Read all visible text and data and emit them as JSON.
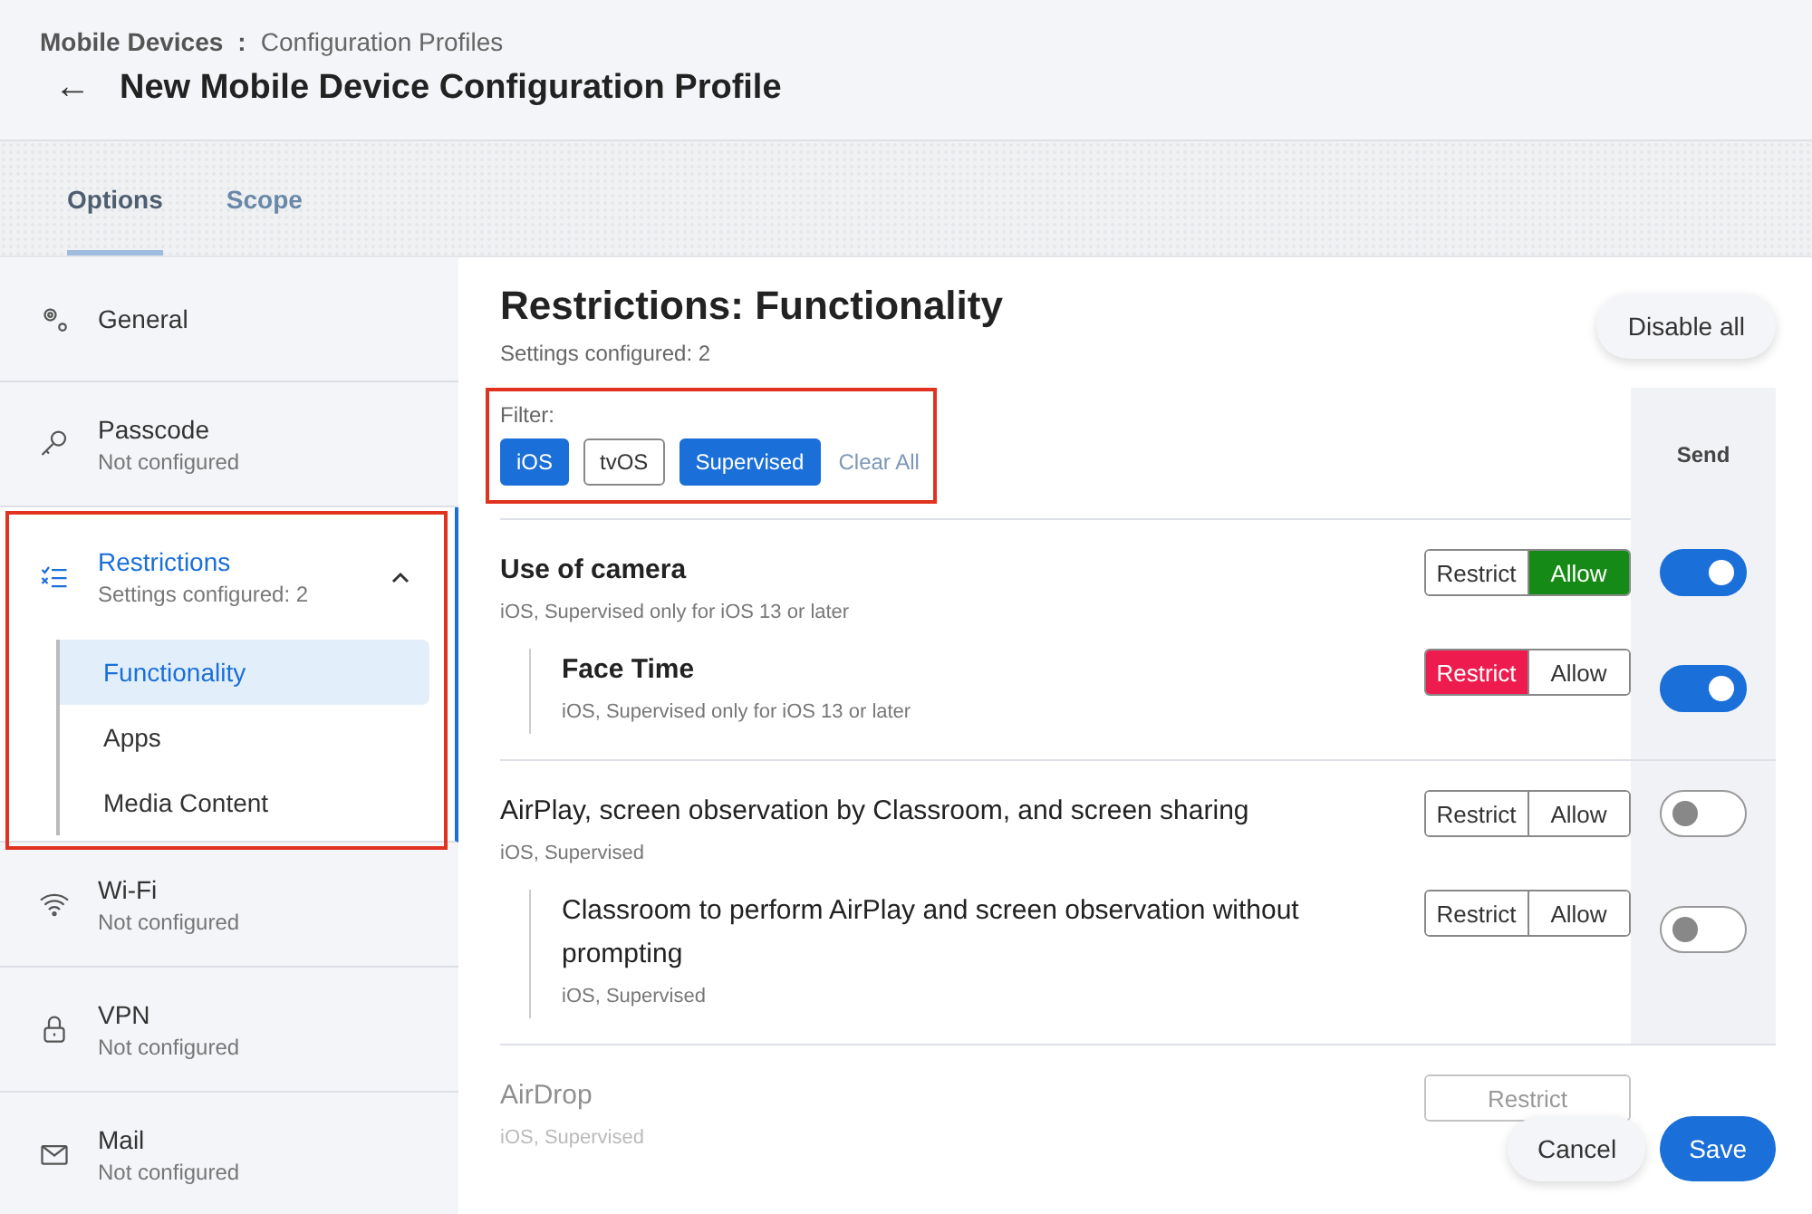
{
  "breadcrumb": {
    "parent": "Mobile Devices",
    "separator": ":",
    "current": "Configuration Profiles"
  },
  "back": "←",
  "title": "New Mobile Device Configuration Profile",
  "tabs": [
    {
      "label": "Options",
      "selected": true
    },
    {
      "label": "Scope",
      "selected": false
    }
  ],
  "sidebar": {
    "items": [
      {
        "kind": "gear",
        "label": "General",
        "selected": false
      },
      {
        "kind": "key",
        "label": "Passcode",
        "status": "Not configured",
        "selected": false
      },
      {
        "kind": "checklist",
        "label": "Restrictions",
        "status": "Settings configured: 2",
        "selected": true,
        "expanded": true,
        "highlighted": true,
        "children": [
          {
            "label": "Functionality",
            "selected": true
          },
          {
            "label": "Apps",
            "selected": false
          },
          {
            "label": "Media Content",
            "selected": false
          }
        ]
      },
      {
        "kind": "wifi",
        "label": "Wi-Fi",
        "status": "Not configured",
        "selected": false
      },
      {
        "kind": "lock",
        "label": "VPN",
        "status": "Not configured",
        "selected": false
      },
      {
        "kind": "mail",
        "label": "Mail",
        "status": "Not configured",
        "selected": false
      }
    ]
  },
  "panel": {
    "title": "Restrictions: Functionality",
    "subtitle": "Settings configured: 2",
    "disable_all": "Disable all",
    "filter": {
      "label": "Filter:",
      "highlighted": true,
      "chips": [
        {
          "label": "iOS",
          "selected": true
        },
        {
          "label": "tvOS",
          "selected": false
        },
        {
          "label": "Supervised",
          "selected": true
        }
      ],
      "clear": "Clear All"
    },
    "send_header": "Send",
    "settings": [
      {
        "title": "Use of camera",
        "bold": true,
        "subtitle": "iOS, Supervised only for iOS 13 or later",
        "options": [
          {
            "label": "Restrict",
            "selected": false
          },
          {
            "label": "Allow",
            "selected": true
          }
        ],
        "send": true,
        "faded": false,
        "children": [
          {
            "title": "Face Time",
            "bold": true,
            "subtitle": "iOS, Supervised only for iOS 13 or later",
            "options": [
              {
                "label": "Restrict",
                "selected": true
              },
              {
                "label": "Allow",
                "selected": false
              }
            ],
            "send": true
          }
        ]
      },
      {
        "title": "AirPlay, screen observation by Classroom, and screen sharing",
        "bold": false,
        "subtitle": "iOS, Supervised",
        "options": [
          {
            "label": "Restrict",
            "selected": false
          },
          {
            "label": "Allow",
            "selected": false
          }
        ],
        "send": false,
        "faded": false,
        "children": [
          {
            "title": "Classroom to perform AirPlay and screen observation without prompting",
            "bold": false,
            "subtitle": "iOS, Supervised",
            "options": [
              {
                "label": "Restrict",
                "selected": false
              },
              {
                "label": "Allow",
                "selected": false
              }
            ],
            "send": false
          }
        ]
      },
      {
        "title": "AirDrop",
        "bold": false,
        "subtitle": "iOS, Supervised",
        "options": [
          {
            "label": "Restrict",
            "selected": false
          }
        ],
        "faded": true
      }
    ]
  },
  "footer": {
    "cancel": "Cancel",
    "save": "Save"
  }
}
